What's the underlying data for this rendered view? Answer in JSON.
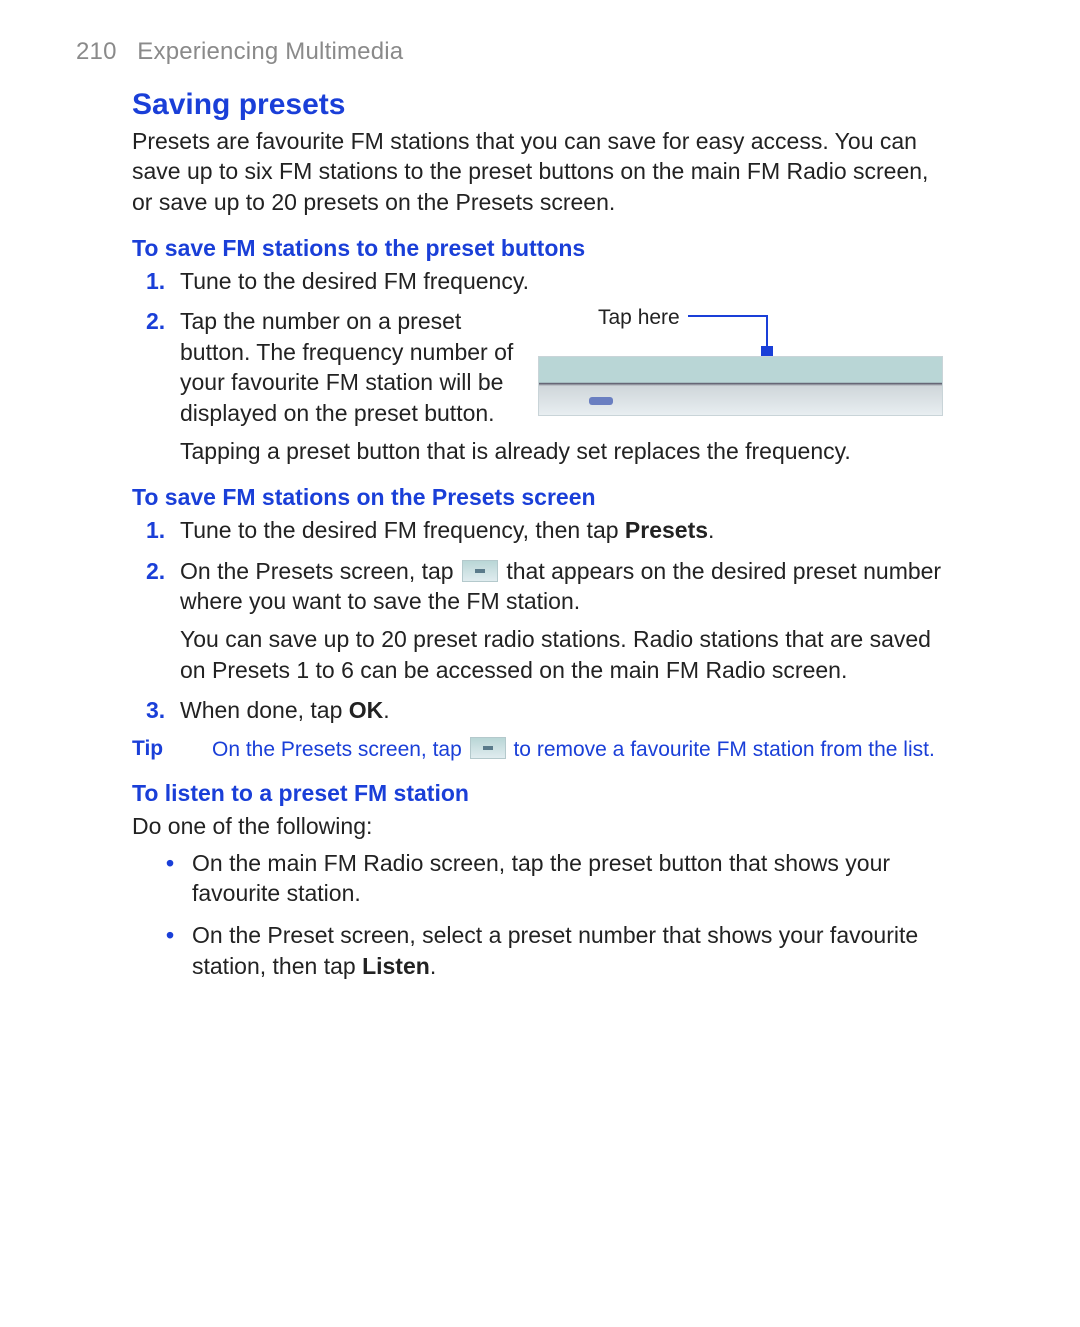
{
  "header": {
    "pageNum": "210",
    "chapter": "Experiencing Multimedia"
  },
  "title": "Saving presets",
  "intro": "Presets are favourite FM stations that you can save for easy access. You can save up to six FM stations to the preset buttons on the main FM Radio screen, or save up to 20 presets on the Presets screen.",
  "section1": {
    "heading": "To save FM stations to the preset buttons",
    "step1": "Tune to the desired FM frequency.",
    "step2a": "Tap the number on a preset button. The frequency number of your favourite FM station will be displayed on the preset button.",
    "step2b": "Tapping a preset button that is already set replaces the frequency.",
    "tapHere": "Tap here"
  },
  "section2": {
    "heading": "To save FM stations on the Presets screen",
    "step1_pre": "Tune to the desired FM frequency, then tap ",
    "step1_bold": "Presets",
    "step1_post": ".",
    "step2_pre": "On the Presets screen, tap ",
    "step2_post": " that appears on the desired preset number where you want to save the FM station.",
    "step2_extra": "You can save up to 20 preset radio stations. Radio stations that are saved on Presets 1 to 6 can be accessed on the main FM Radio screen.",
    "step3_pre": "When done, tap ",
    "step3_bold": "OK",
    "step3_post": "."
  },
  "tip": {
    "label": "Tip",
    "pre": "On the Presets screen, tap ",
    "post": " to remove a favourite FM station from the list."
  },
  "section3": {
    "heading": "To listen to a preset FM station",
    "lead": "Do one of the following:",
    "bullet1": "On the main FM Radio screen, tap the preset button that shows your favourite station.",
    "bullet2_pre": "On the Preset screen, select a preset number that shows your favourite station, then tap ",
    "bullet2_bold": "Listen",
    "bullet2_post": "."
  },
  "numbers": {
    "n1": "1.",
    "n2": "2.",
    "n3": "3."
  }
}
